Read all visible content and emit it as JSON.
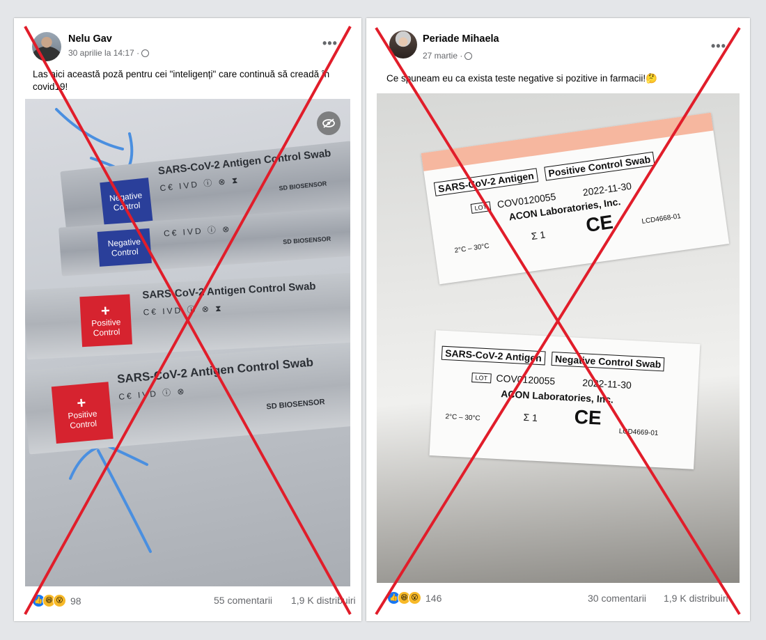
{
  "posts": [
    {
      "author": "Nelu Gav",
      "meta": "30 aprilie la 14:17 ·",
      "text": "Las aici această poză pentru cei \"inteligenți\" care continuă să creadă în covid19!",
      "reaction_count": "98",
      "comments": "55 comentarii",
      "shares": "1,9 K distribuiri",
      "photo": {
        "strip_title": "SARS-CoV-2 Antigen Control Swab",
        "brand": "SD BIOSENSOR",
        "negative_label": "Negative Control",
        "positive_label": "Positive Control",
        "plus": "+"
      }
    },
    {
      "author": "Periade Mihaela",
      "meta": "27 martie ·",
      "text": "Ce spuneam eu ca exista teste negative si pozitive in farmacii!🤔",
      "reaction_count": "146",
      "comments": "30 comentarii",
      "shares": "1,9 K distribuiri",
      "photo": {
        "label1": {
          "antigen": "SARS-CoV-2 Antigen",
          "kind": "Positive Control Swab",
          "lot_tag": "LOT",
          "lot": "COV0120055",
          "expiry": "2022-11-30",
          "maker": "ACON Laboratories, Inc.",
          "code": "LCD4668-01",
          "ce": "CE",
          "sigma": "Σ 1",
          "temp": "2°C – 30°C"
        },
        "label2": {
          "antigen": "SARS-CoV-2 Antigen",
          "kind": "Negative Control Swab",
          "lot_tag": "LOT",
          "lot": "COV0120055",
          "expiry": "2022-11-30",
          "maker": "ACON Laboratories, Inc.",
          "code": "LCD4669-01",
          "ce": "CE",
          "sigma": "Σ 1",
          "temp": "2°C – 30°C"
        }
      }
    }
  ],
  "icons": {
    "more": "more-options-icon",
    "globe": "globe-icon",
    "hide": "hide-eye-icon",
    "like": "like-reaction-icon",
    "haha": "haha-reaction-icon",
    "wow": "wow-reaction-icon"
  },
  "colors": {
    "cross": "#e11d2a",
    "negative_box": "#2a3f9a",
    "positive_box": "#d6232f",
    "like": "#1877f2"
  }
}
